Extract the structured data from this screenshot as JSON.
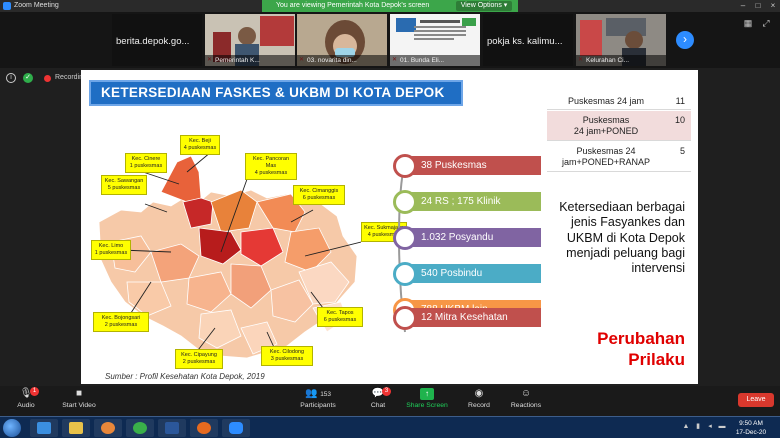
{
  "window": {
    "title": "Zoom Meeting",
    "viewing_banner": "You are viewing Pemerintah Kota Depok's screen",
    "view_options": "View Options ▾"
  },
  "participants_strip": [
    {
      "name": "berita.depok.go...",
      "type": "text"
    },
    {
      "name": "Pemerintah K...",
      "type": "video"
    },
    {
      "name": "03. novarita din...",
      "type": "video"
    },
    {
      "name": "01. Bunda Eli...",
      "type": "video"
    },
    {
      "name": "pokja ks. kalimu...",
      "type": "text"
    },
    {
      "name": "Kelurahan Ci...",
      "type": "video"
    }
  ],
  "status_row": {
    "recording_label": "Recording..."
  },
  "slide": {
    "title": "KETERSEDIAAN FASKES & UKBM DI KOTA DEPOK",
    "source": "Sumber : Profil Kesehatan Kota Depok, 2019",
    "callouts": [
      {
        "name": "Kec. Beji",
        "count": "4 puskesmas"
      },
      {
        "name": "Kec. Cinere",
        "count": "1 puskesmas"
      },
      {
        "name": "Kec. Pancoran Mas",
        "count": "4 puskesmas"
      },
      {
        "name": "Kec. Sawangan",
        "count": "5 puskesmas"
      },
      {
        "name": "Kec. Cimanggis",
        "count": "6 puskesmas"
      },
      {
        "name": "Kec. Limo",
        "count": "1 puskesmas"
      },
      {
        "name": "Kec. Sukmajaya",
        "count": "4 puskesmas"
      },
      {
        "name": "Kec. Bojongsari",
        "count": "2 puskesmas"
      },
      {
        "name": "Kec. Tapos",
        "count": "6 puskesmas"
      },
      {
        "name": "Kec. Cipayung",
        "count": "2 puskesmas"
      },
      {
        "name": "Kec. Cilodong",
        "count": "3 puskesmas"
      }
    ],
    "stats": [
      {
        "label": "38 Puskesmas",
        "color": "#c0504d"
      },
      {
        "label": "24 RS ; 175 Klinik",
        "color": "#9bbb59"
      },
      {
        "label": "1.032 Posyandu",
        "color": "#8064a2"
      },
      {
        "label": "540 Posbindu",
        "color": "#4bacc6"
      },
      {
        "label": "788 UKBM lain",
        "color": "#f79646"
      },
      {
        "label": "12 Mitra Kesehatan",
        "color": "#c0504d"
      }
    ],
    "puskesmas_table": [
      {
        "label": "Puskesmas 24 jam",
        "value": "11",
        "shaded": false
      },
      {
        "label": "Puskesmas\n24 jam+PONED",
        "value": "10",
        "shaded": true
      },
      {
        "label": "Puskesmas 24\njam+PONED+RANAP",
        "value": "5",
        "shaded": false
      }
    ],
    "description": "Ketersediaan berbagai jenis Fasyankes dan UKBM di Kota Depok menjadi peluang bagi intervensi",
    "highlight": "Perubahan Prilaku"
  },
  "toolbar": {
    "audio": "Audio",
    "start_video": "Start Video",
    "participants": "Participants",
    "participants_count": "153",
    "chat": "Chat",
    "chat_badge": "3",
    "share_screen": "Share Screen",
    "record": "Record",
    "reactions": "Reactions",
    "leave": "Leave",
    "audio_badge": "1"
  },
  "taskbar": {
    "time": "9:50 AM",
    "date": "17-Dec-20"
  },
  "colors": {
    "accent": "#2d8cff",
    "slide_title": "#1f6ec4",
    "highlight": "#e00000"
  }
}
